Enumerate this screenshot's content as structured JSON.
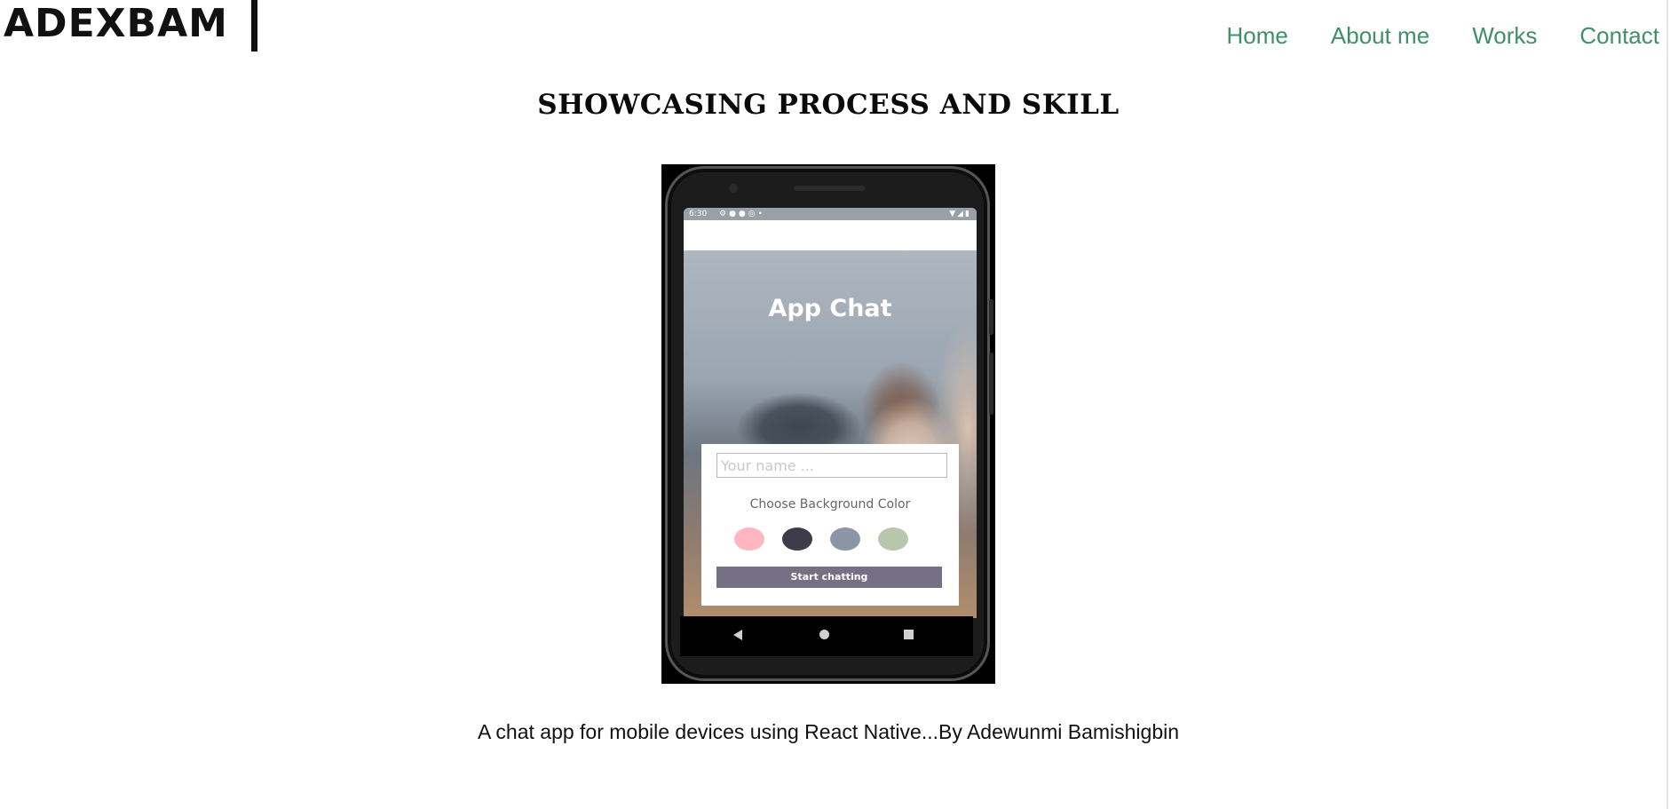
{
  "header": {
    "brand": "ADEXBAM",
    "nav": [
      {
        "label": "Home"
      },
      {
        "label": "About me"
      },
      {
        "label": "Works"
      },
      {
        "label": "Contact"
      }
    ],
    "nav_color": "#3f8f6a"
  },
  "main": {
    "title": "SHOWCASING PROCESS AND SKILL",
    "caption": "A chat app for mobile devices using React Native...By Adewunmi Bamishigbin"
  },
  "phone_screen": {
    "status_time": "6:30",
    "app_title": "App Chat",
    "name_placeholder": "Your name ...",
    "bg_label": "Choose Background Color",
    "swatches": [
      "#ffb6c1",
      "#3e3b4b",
      "#8a95a5",
      "#b9c6ae"
    ],
    "start_button": "Start chatting",
    "start_button_color": "#757083"
  }
}
